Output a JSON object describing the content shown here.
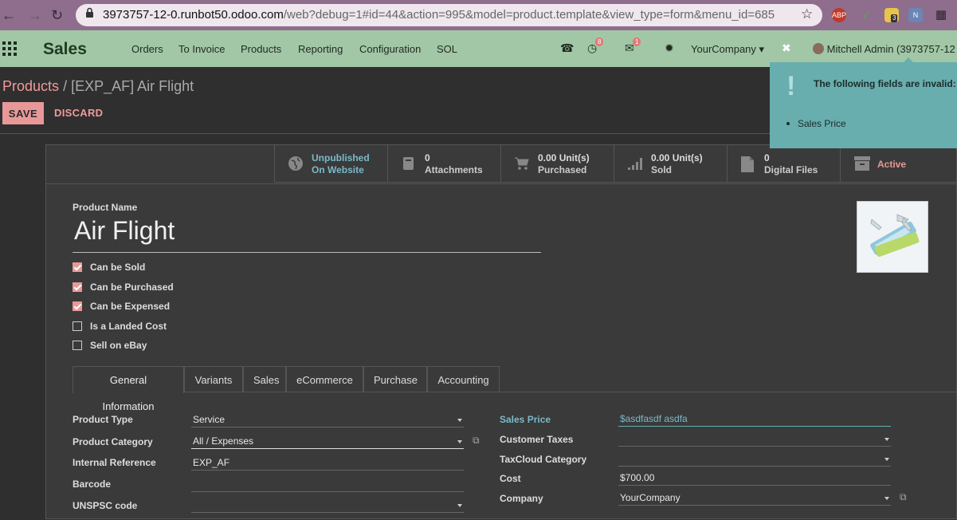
{
  "browser": {
    "url_host": "3973757-12-0.runbot50.odoo.com",
    "url_rest": "/web?debug=1#id=44&action=995&model=product.template&view_type=form&menu_id=685",
    "ext_badge_count": "3",
    "ext_abp": "ABP"
  },
  "navbar": {
    "app_name": "Sales",
    "menus": [
      "Orders",
      "To Invoice",
      "Products",
      "Reporting",
      "Configuration",
      "SOL"
    ],
    "activity_count": "8",
    "message_count": "1",
    "company": "YourCompany",
    "user": "Mitchell Admin (3973757-12"
  },
  "breadcrumb": {
    "parent": "Products",
    "separator": "/",
    "current": "[EXP_AF] Air Flight"
  },
  "actions": {
    "save": "SAVE",
    "discard": "DISCARD"
  },
  "smart_buttons": [
    {
      "value": "Unpublished",
      "label": "On Website",
      "icon": "globe-icon"
    },
    {
      "value": "0",
      "label": "Attachments",
      "icon": "book-icon"
    },
    {
      "value": "0.00 Unit(s)",
      "label": "Purchased",
      "icon": "cart-icon"
    },
    {
      "value": "0.00 Unit(s)",
      "label": "Sold",
      "icon": "signal-icon"
    },
    {
      "value": "0",
      "label": "Digital Files",
      "icon": "file-icon"
    },
    {
      "value": "Active",
      "label": "",
      "icon": "archive-icon"
    }
  ],
  "product": {
    "name_label": "Product Name",
    "name": "Air Flight",
    "checkboxes": [
      {
        "label": "Can be Sold",
        "checked": true
      },
      {
        "label": "Can be Purchased",
        "checked": true
      },
      {
        "label": "Can be Expensed",
        "checked": true
      },
      {
        "label": "Is a Landed Cost",
        "checked": false
      },
      {
        "label": "Sell on eBay",
        "checked": false
      }
    ]
  },
  "tabs": [
    "General Information",
    "Variants",
    "Sales",
    "eCommerce",
    "Purchase",
    "Accounting"
  ],
  "left_fields": [
    {
      "label": "Product Type",
      "value": "Service"
    },
    {
      "label": "Product Category",
      "value": "All / Expenses"
    },
    {
      "label": "Internal Reference",
      "value": "EXP_AF"
    },
    {
      "label": "Barcode",
      "value": ""
    },
    {
      "label": "UNSPSC code",
      "value": ""
    }
  ],
  "right_fields": [
    {
      "label": "Sales Price",
      "value": "$asdfasdf asdfa"
    },
    {
      "label": "Customer Taxes",
      "value": ""
    },
    {
      "label": "TaxCloud Category",
      "value": ""
    },
    {
      "label": "Cost",
      "value": "$700.00"
    },
    {
      "label": "Company",
      "value": "YourCompany"
    }
  ],
  "notification": {
    "title": "The following fields are invalid:",
    "items": [
      "Sales Price"
    ]
  },
  "colors": {
    "navbar": "#a2c7a6",
    "accent": "#e89898",
    "notify": "#68aeae",
    "invalid_field": "#68aeae"
  }
}
